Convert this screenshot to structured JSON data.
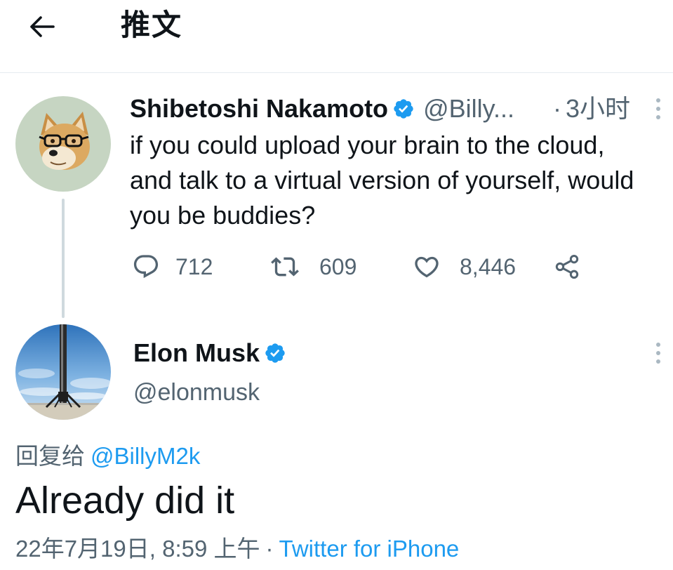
{
  "header": {
    "back_icon": "arrow-left-icon",
    "title": "推文"
  },
  "parent_tweet": {
    "avatar": "doge-avatar",
    "display_name": "Shibetoshi Nakamoto",
    "verified_icon": "verified-badge-icon",
    "handle": "@Billy...",
    "separator": "·",
    "time": "3小时",
    "more_icon": "more-vertical-icon",
    "text_lines": [
      "if you could upload your brain to the cloud,",
      "and talk to a virtual version of yourself, would",
      "you be buddies?"
    ],
    "actions": {
      "reply_icon": "reply-icon",
      "replies": "712",
      "retweet_icon": "retweet-icon",
      "retweets": "609",
      "like_icon": "heart-icon",
      "likes": "8,446",
      "share_icon": "share-icon"
    }
  },
  "main_tweet": {
    "avatar": "rocket-avatar",
    "display_name": "Elon Musk",
    "verified_icon": "verified-badge-icon",
    "handle": "@elonmusk",
    "more_icon": "more-vertical-icon",
    "reply_prefix": "回复给",
    "reply_to": "@BillyM2k",
    "text": "Already did it",
    "date": "22年7月19日, 8:59 上午",
    "separator": "·",
    "source": "Twitter for iPhone"
  },
  "colors": {
    "text": "#0f1419",
    "secondary": "#536471",
    "accent": "#1d9bf0",
    "thread_line": "#cfd9de"
  }
}
